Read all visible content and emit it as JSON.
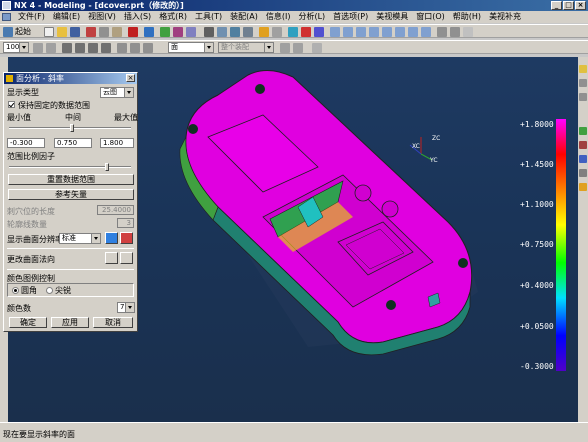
{
  "window": {
    "title": "NX 4 - Modeling - [dcover.prt（修改的）]",
    "controls": [
      "_",
      "□",
      "×"
    ]
  },
  "menubar": {
    "items": [
      "文件(F)",
      "编辑(E)",
      "视图(V)",
      "插入(S)",
      "格式(R)",
      "工具(T)",
      "装配(A)",
      "信息(I)",
      "分析(L)",
      "首选项(P)",
      "美视模具",
      "窗口(O)",
      "帮助(H)",
      "美视补充"
    ]
  },
  "toolbar1": {
    "start_label": "起始"
  },
  "toolbar2": {
    "zoom_value": "100",
    "face_combo": "面",
    "assembly_combo": "整个装配"
  },
  "dialog": {
    "title": "面分析 - 斜率",
    "display_type_label": "显示类型",
    "display_type_value": "云图",
    "keep_range_label": "保持固定的数据范围",
    "keep_range_checked": true,
    "min_label": "最小值",
    "mid_label": "中间",
    "max_label": "最大值",
    "min_value": "-0.300",
    "mid_value": "0.750",
    "max_value": "1.800",
    "range_scale_label": "范围比例因子",
    "reset_range_button": "重置数据范围",
    "reference_vector_button": "参考矢量",
    "spike_length_label": "刺穴位的长度",
    "spike_length_value": "25.4000",
    "contour_count_label": "轮廓线数量",
    "contour_count_value": "3",
    "resolution_label": "显示曲面分辨率",
    "resolution_value": "标准",
    "normal_label": "更改曲面法向",
    "legend_control_label": "颜色图例控制",
    "legend_round": "圆角",
    "legend_sharp": "尖锐",
    "legend_round_selected": true,
    "color_count_label": "颜色数",
    "color_count_value": "7",
    "ok_button": "确定",
    "apply_button": "应用",
    "cancel_button": "取消"
  },
  "legend": {
    "values": [
      "+1.8000",
      "+1.4500",
      "+1.1000",
      "+0.7500",
      "+0.4000",
      "+0.0500",
      "-0.3000"
    ]
  },
  "axes": {
    "x_label": "XC",
    "y_label": "YC",
    "z_label": "ZC"
  },
  "status": {
    "text": "现在要显示斜率的面"
  },
  "colors": {
    "accent_title": "#0a246a",
    "viewport": "#1e3a62",
    "model": "#e000e0"
  }
}
